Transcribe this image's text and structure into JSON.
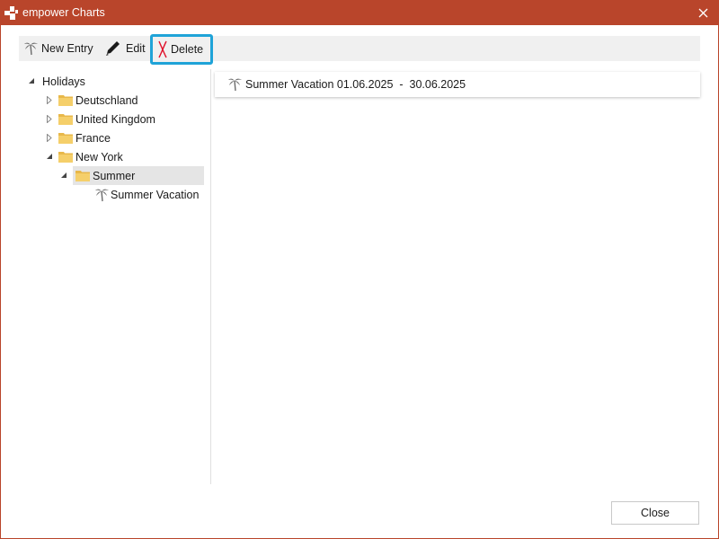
{
  "window": {
    "title": "empower Charts",
    "accent_color": "#b9452b",
    "close_icon": "close-icon"
  },
  "toolbar": {
    "new_entry_label": "New Entry",
    "edit_label": "Edit",
    "delete_label": "Delete",
    "highlight_color": "#1fa3d8"
  },
  "tree": {
    "root": {
      "label": "Holidays",
      "expanded": true
    },
    "countries": [
      {
        "label": "Deutschland",
        "expanded": false
      },
      {
        "label": "United Kingdom",
        "expanded": false
      },
      {
        "label": "France",
        "expanded": false
      },
      {
        "label": "New York",
        "expanded": true
      }
    ],
    "season": {
      "label": "Summer",
      "expanded": true,
      "selected": true
    },
    "entry": {
      "label": "Summer Vacation",
      "icon": "palm-tree-icon"
    }
  },
  "entries": [
    {
      "text": "Summer Vacation 01.06.2025  -  30.06.2025",
      "icon": "palm-tree-icon"
    }
  ],
  "footer": {
    "close_label": "Close"
  }
}
